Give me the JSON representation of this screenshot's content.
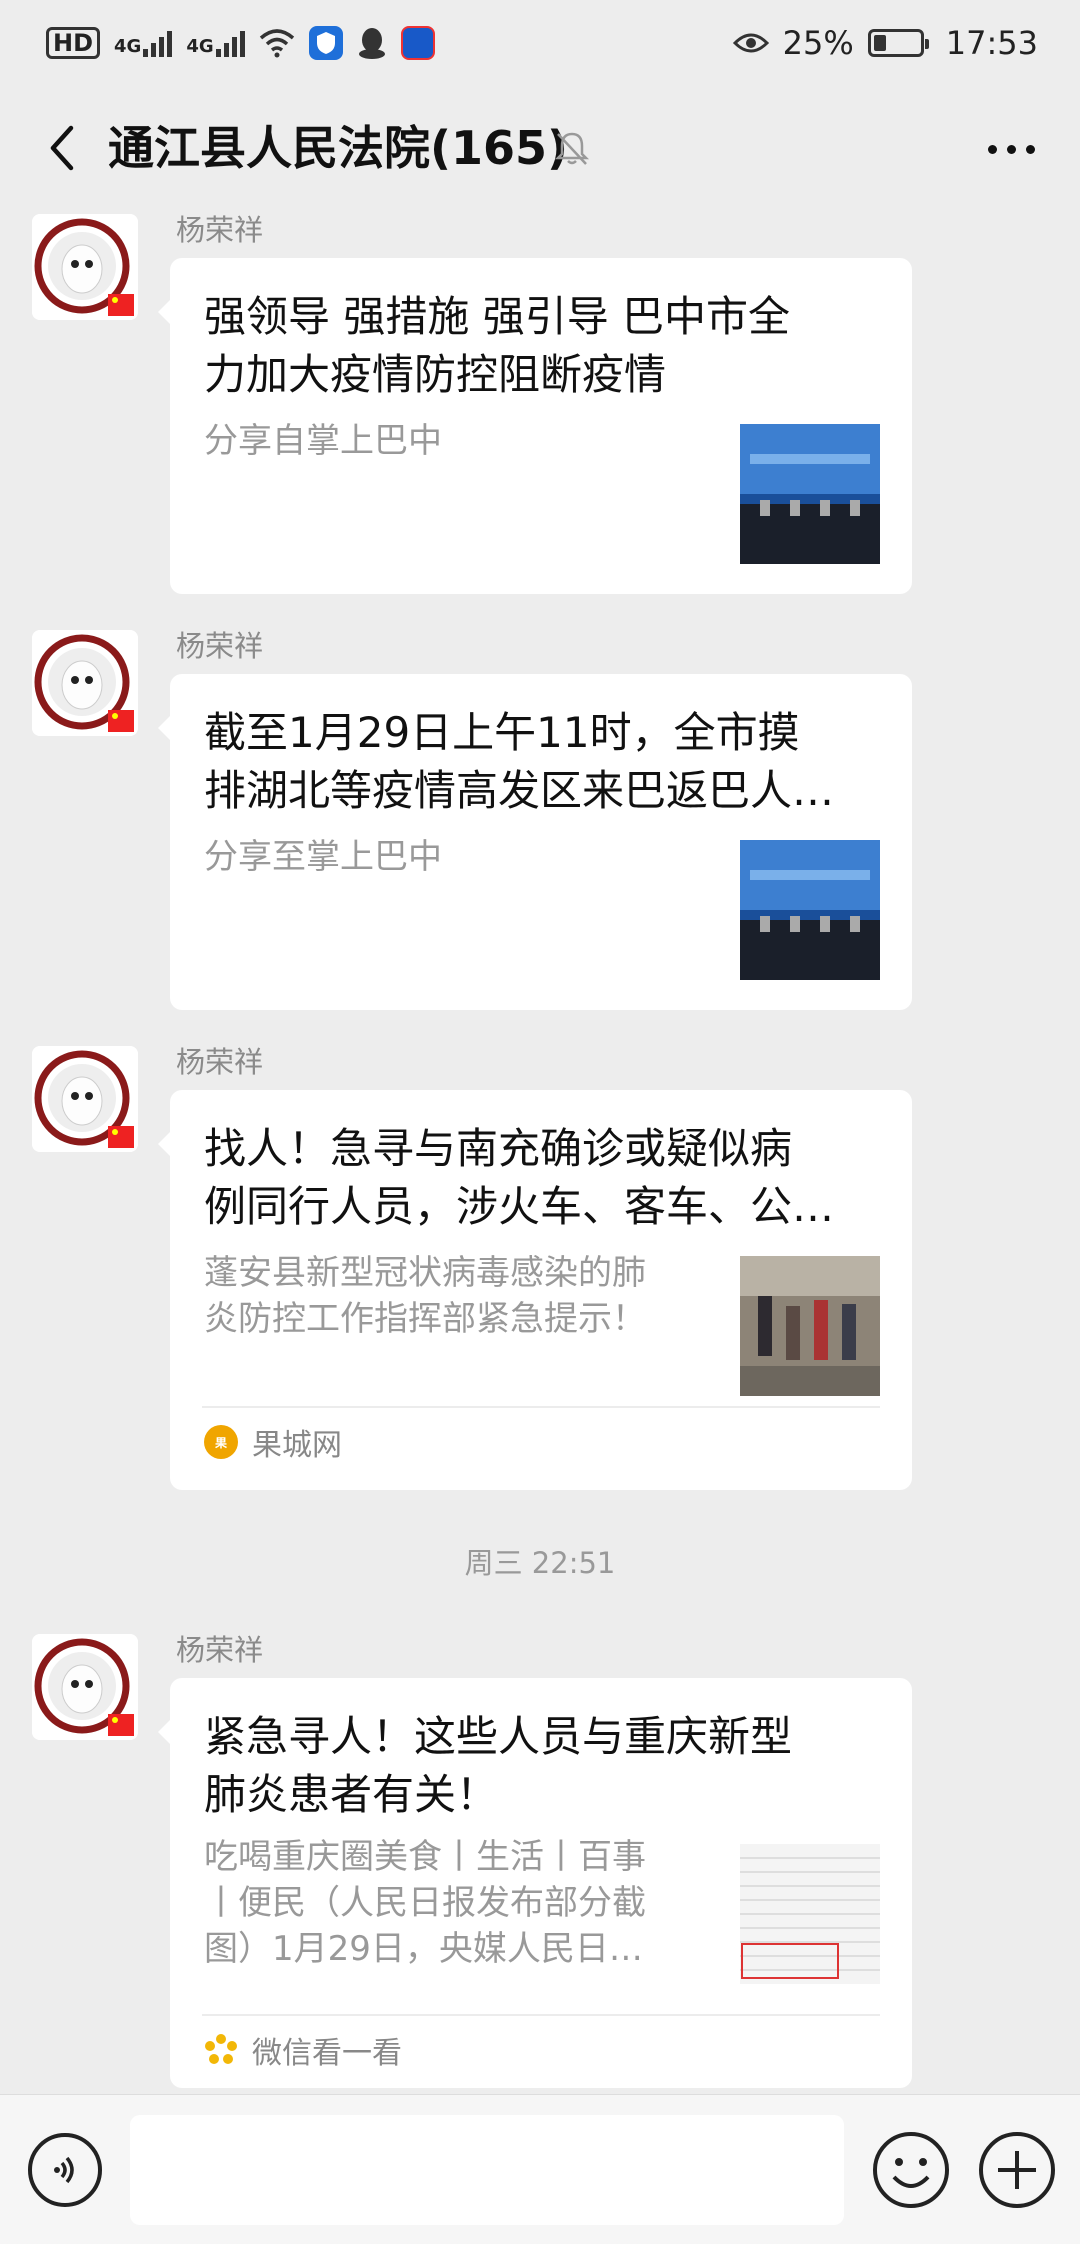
{
  "status_bar": {
    "left_badge": "HD",
    "network_1": "4G",
    "network_2": "4G",
    "battery_percent": "25%",
    "time": "17:53"
  },
  "header": {
    "title": "通江县人民法院(165)"
  },
  "messages": [
    {
      "sender": "杨荣祥",
      "title_lines": [
        " 强领导 强措施 强引导 巴中市全",
        "力加大疫情防控阻断疫情"
      ],
      "desc_lines": [
        "分享自掌上巴中"
      ]
    },
    {
      "sender": "杨荣祥",
      "title_lines": [
        "截至1月29日上午11时，全市摸",
        "排湖北等疫情高发区来巴返巴人…"
      ],
      "desc_lines": [
        "分享至掌上巴中"
      ]
    },
    {
      "sender": "杨荣祥",
      "title_lines": [
        "找人！急寻与南充确诊或疑似病",
        "例同行人员，涉火车、客车、公…"
      ],
      "desc_lines": [
        "蓬安县新型冠状病毒感染的肺",
        "炎防控工作指挥部紧急提示！"
      ],
      "source": "果城网"
    },
    {
      "sender": "杨荣祥",
      "title_lines": [
        "紧急寻人！这些人员与重庆新型",
        "肺炎患者有关！"
      ],
      "desc_lines": [
        "吃喝重庆圈美食丨生活丨百事",
        "丨便民（人民日报发布部分截",
        "图）1月29日，央媒人民日…"
      ],
      "source": "微信看一看"
    }
  ],
  "timestamp_divider": "周三 22:51",
  "colors": {
    "background": "#ededed",
    "bubble": "#ffffff",
    "muted_text": "#999999"
  }
}
